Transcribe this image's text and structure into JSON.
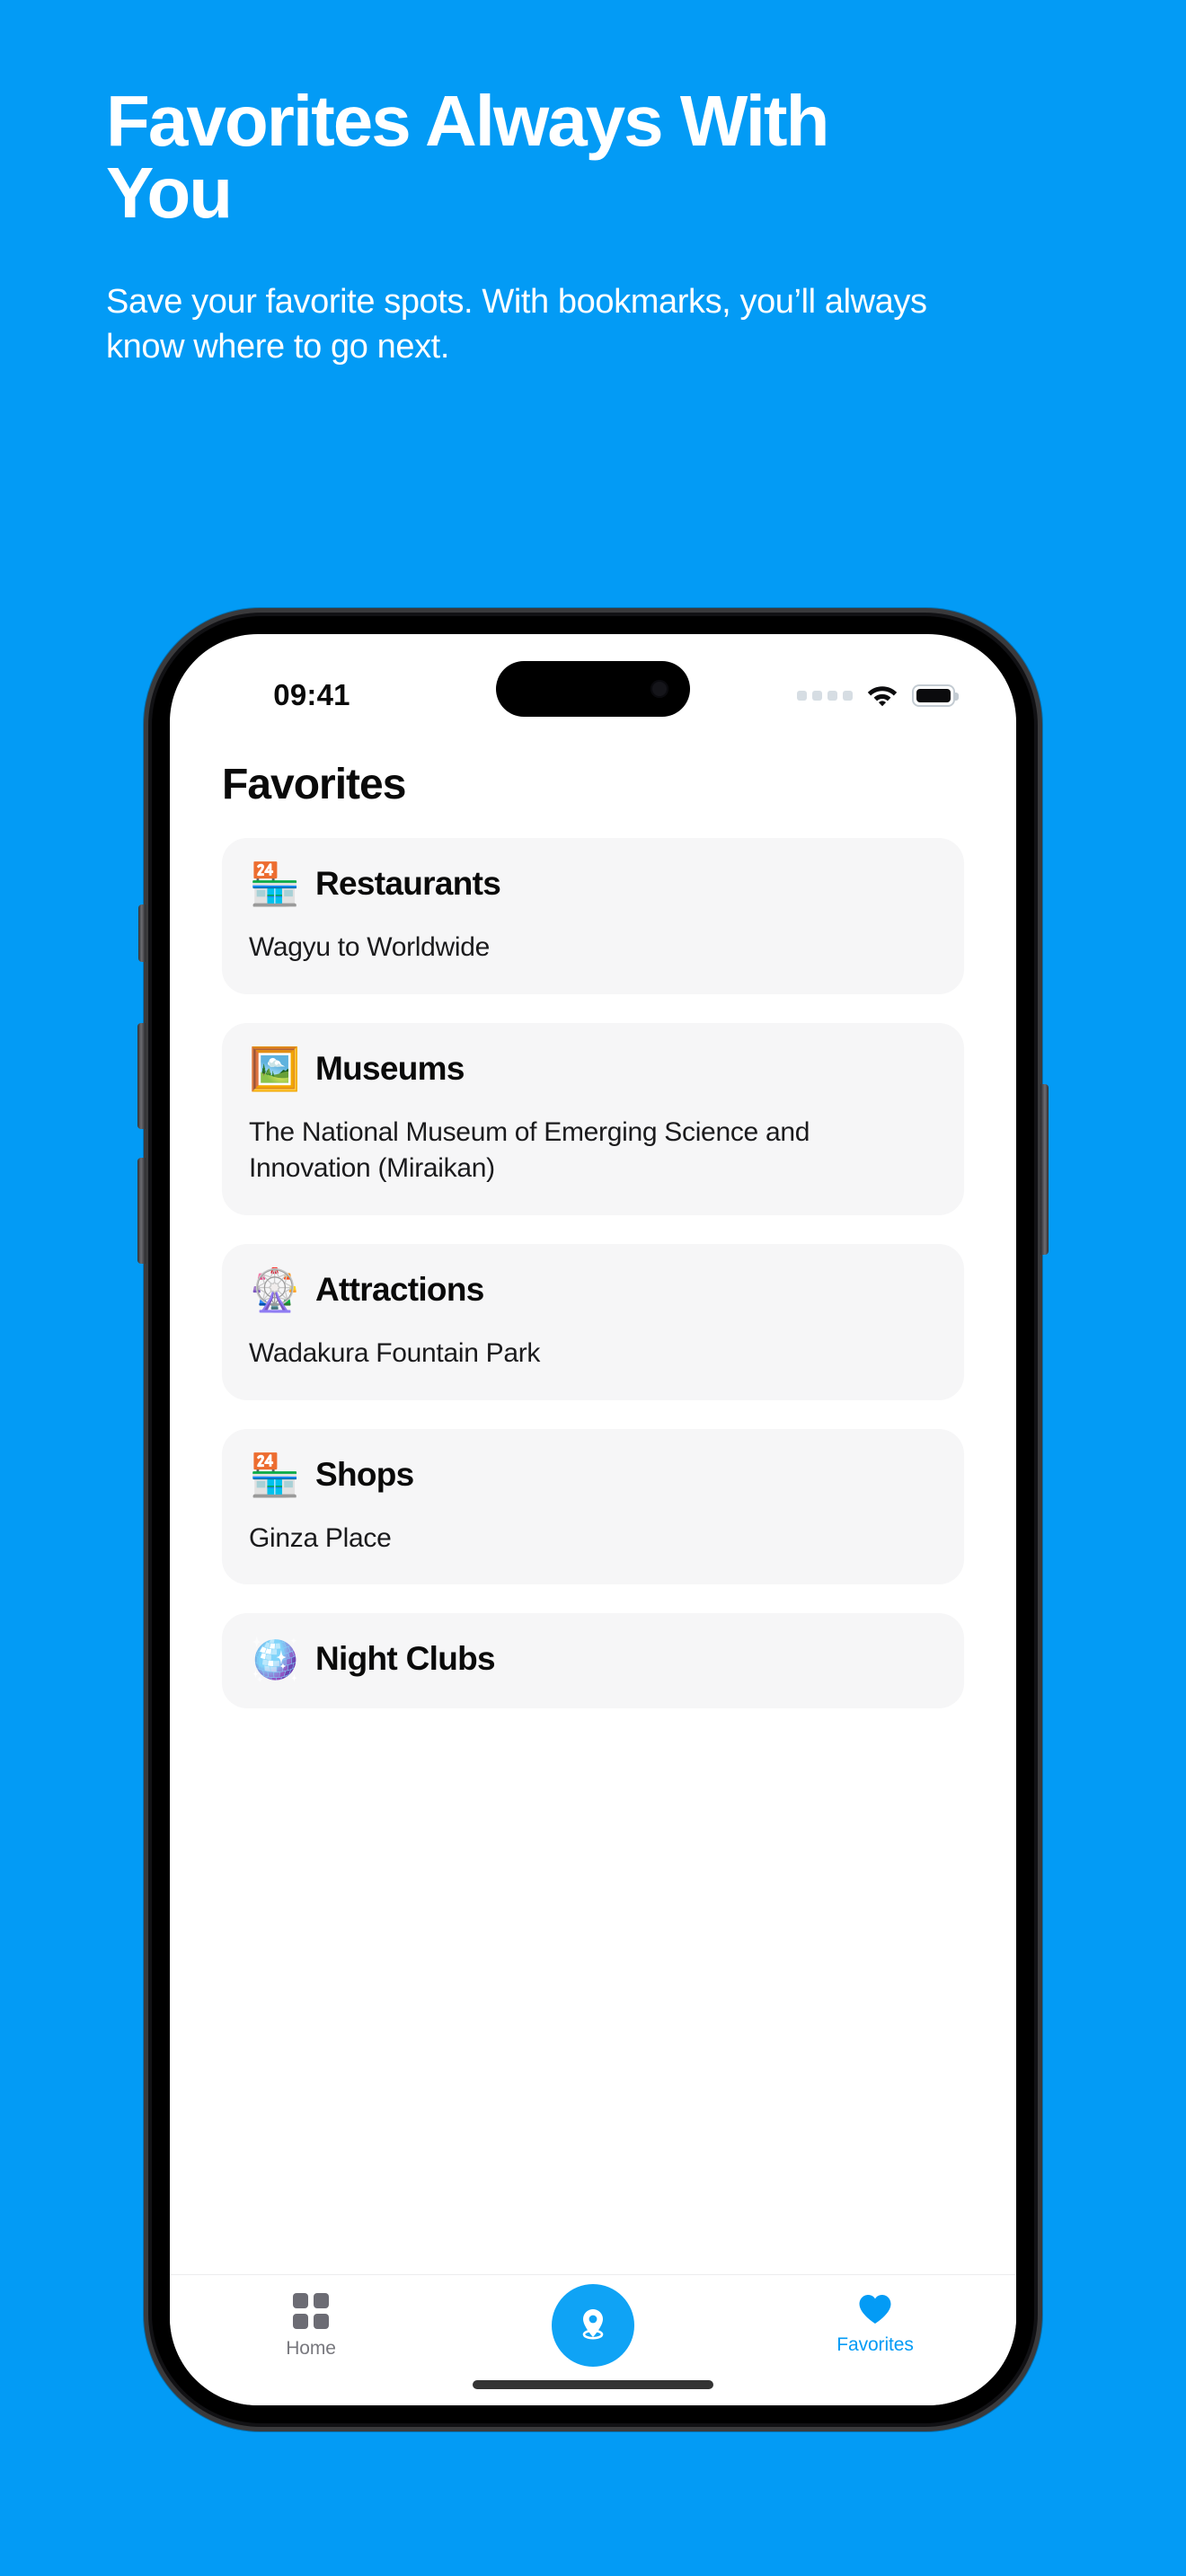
{
  "theme": {
    "brand": "#039BF5",
    "accent": "#0FA3F5",
    "card_bg": "#f6f6f7",
    "text": "#0a0a0a"
  },
  "promo": {
    "title": "Favorites Always With You",
    "subtitle": "Save your favorite spots. With bookmarks, you’ll always know where to go next."
  },
  "status_bar": {
    "time": "09:41",
    "signal_icon": "signal-dots-icon",
    "wifi_icon": "wifi-icon",
    "battery_icon": "battery-full-icon"
  },
  "app": {
    "page_title": "Favorites",
    "cards": [
      {
        "emoji": "🏪",
        "icon_name": "restaurant-emoji",
        "title": "Restaurants",
        "description": "Wagyu to Worldwide"
      },
      {
        "emoji": "🖼️",
        "icon_name": "museum-emoji",
        "title": "Museums",
        "description": "The National Museum of Emerging Science and Innovation (Miraikan)"
      },
      {
        "emoji": "🎡",
        "icon_name": "ferris-wheel-emoji",
        "title": "Attractions",
        "description": "Wadakura Fountain Park"
      },
      {
        "emoji": "🏪",
        "icon_name": "shop-emoji",
        "title": "Shops",
        "description": "Ginza Place"
      },
      {
        "emoji": "🪩",
        "icon_name": "disco-ball-emoji",
        "title": "Night Clubs",
        "description": ""
      }
    ]
  },
  "tabbar": {
    "tabs": [
      {
        "label": "Home",
        "icon": "grid-icon",
        "active": false
      },
      {
        "label": "",
        "icon": "location-pin-icon",
        "active": false
      },
      {
        "label": "Favorites",
        "icon": "heart-icon",
        "active": true
      }
    ]
  }
}
